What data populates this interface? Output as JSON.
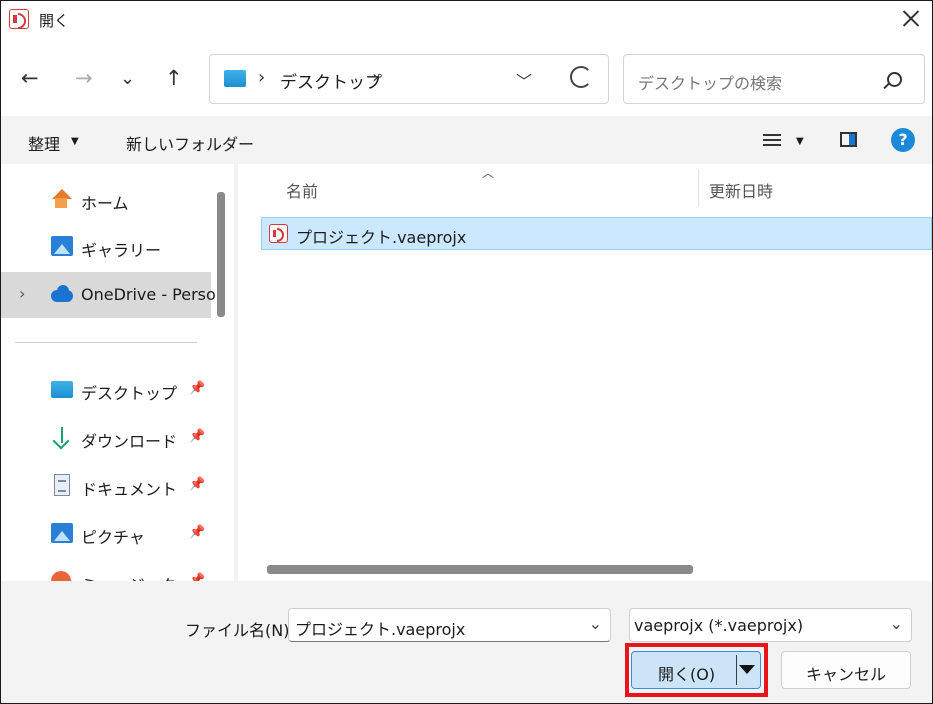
{
  "window": {
    "title": "開く",
    "accent": "#e8161b"
  },
  "nav": {
    "address_segment": "デスクトップ",
    "address_chevron": "›",
    "search_placeholder": "デスクトップの検索"
  },
  "toolbar": {
    "organize": "整理",
    "new_folder": "新しいフォルダー",
    "help": "?"
  },
  "sidebar": {
    "items": [
      {
        "label": "ホーム",
        "icon": "home-icon"
      },
      {
        "label": "ギャラリー",
        "icon": "gallery-icon"
      },
      {
        "label": "OneDrive - Perso",
        "icon": "cloud-icon"
      },
      {
        "label": "デスクトップ",
        "icon": "desktop-icon"
      },
      {
        "label": "ダウンロード",
        "icon": "download-icon"
      },
      {
        "label": "ドキュメント",
        "icon": "document-icon"
      },
      {
        "label": "ピクチャ",
        "icon": "picture-icon"
      },
      {
        "label": "ミュージック",
        "icon": "music-icon"
      }
    ]
  },
  "file_list": {
    "columns": [
      "名前",
      "更新日時"
    ],
    "files": [
      {
        "name": "プロジェクト.vaeprojx",
        "selected": true
      }
    ]
  },
  "bottom": {
    "filename_label": "ファイル名(N):",
    "filename_value": "プロジェクト.vaeprojx",
    "filetype_value": "vaeprojx (*.vaeprojx)",
    "open_label": "開く(O)",
    "cancel_label": "キャンセル"
  }
}
